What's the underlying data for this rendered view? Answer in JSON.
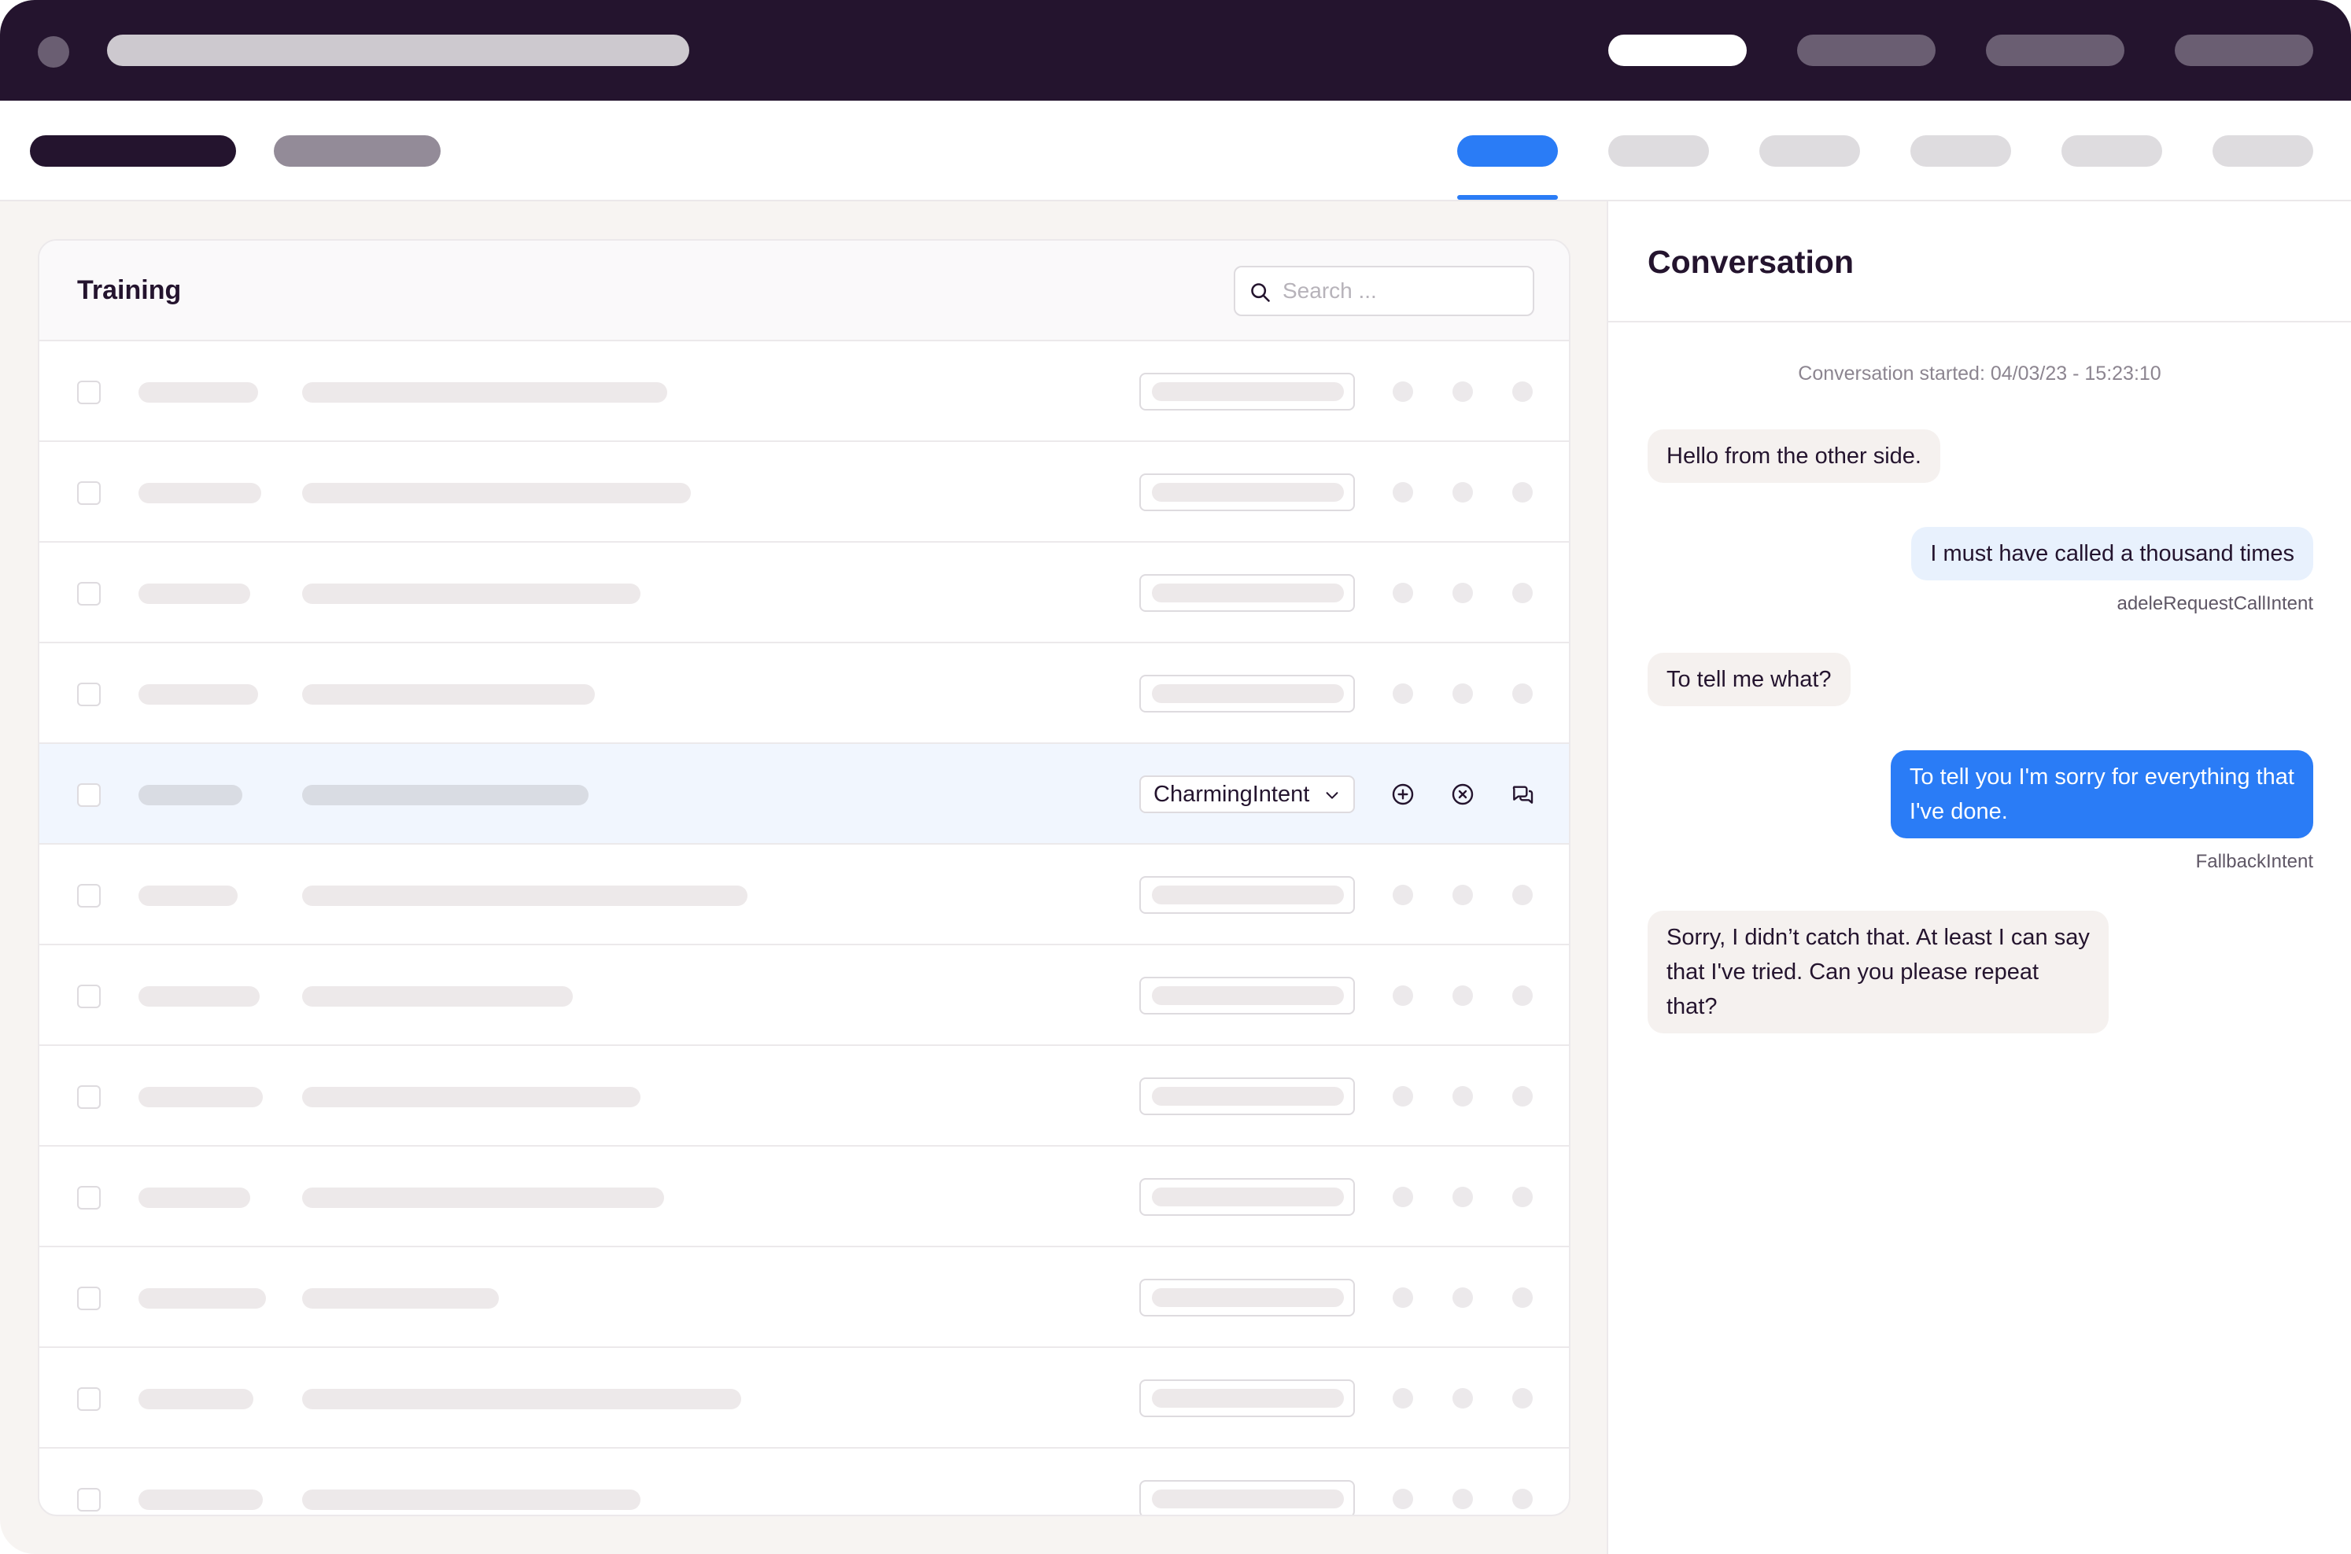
{
  "training": {
    "title": "Training",
    "search_placeholder": "Search ...",
    "selected_intent": "CharmingIntent"
  },
  "conversation": {
    "title": "Conversation",
    "started": "Conversation started: 04/03/23 - 15:23:10",
    "messages": [
      {
        "text": "Hello from the other side."
      },
      {
        "text": "I must have called a thousand times",
        "intent": "adeleRequestCallIntent"
      },
      {
        "text": "To tell me what?"
      },
      {
        "line1": "To tell you I'm sorry for everything that",
        "line2": "I've done.",
        "intent": "FallbackIntent"
      },
      {
        "line1": "Sorry, I didn’t catch that. At least I can say",
        "line2": "that I've tried. Can you please repeat",
        "line3": "that?"
      }
    ]
  },
  "colors": {
    "topbar": "#24142e",
    "accent": "#2a7cf6",
    "selected_row": "#f1f6fe",
    "incoming_bubble": "#f5f1ef",
    "outgoing_bubble": "#e8f1fd"
  },
  "icons": [
    "search-icon",
    "chevron-down-icon",
    "plus-circle-icon",
    "close-circle-icon",
    "chat-bubbles-icon"
  ]
}
